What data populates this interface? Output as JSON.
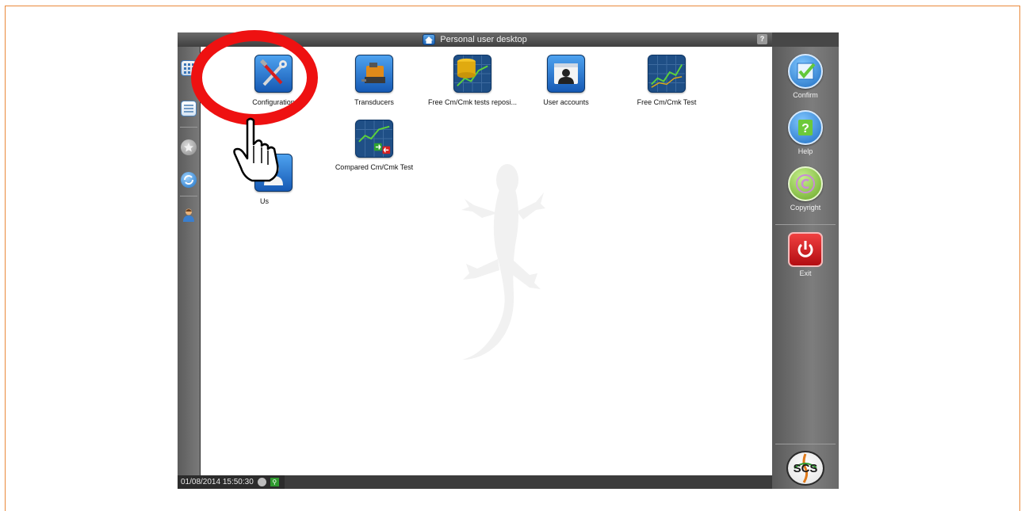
{
  "window": {
    "title": "Personal user desktop",
    "help_button": "?"
  },
  "desktop_icons": [
    {
      "label": "Configuration",
      "icon": "configuration-tools-icon"
    },
    {
      "label": "Transducers",
      "icon": "transducer-icon"
    },
    {
      "label": "Free Cm/Cmk tests reposi...",
      "icon": "tests-repository-icon"
    },
    {
      "label": "User accounts",
      "icon": "user-accounts-icon"
    },
    {
      "label": "Free Cm/Cmk Test",
      "icon": "chart-icon"
    },
    {
      "label": "Us",
      "icon": "user-icon"
    },
    {
      "label": "Compared Cm/Cmk Test",
      "icon": "compared-chart-icon"
    }
  ],
  "right_panel": {
    "confirm_label": "Confirm",
    "help_label": "Help",
    "copyright_label": "Copyright",
    "exit_label": "Exit",
    "logo_text": "SCS"
  },
  "status_bar": {
    "datetime": "01/08/2014 15:50:30"
  },
  "colors": {
    "accent_blue": "#1f6ec2",
    "callout_red": "#ee1111",
    "frame_orange": "#e9883a",
    "exit_red": "#d0151b",
    "confirm_green": "#63c83a"
  }
}
